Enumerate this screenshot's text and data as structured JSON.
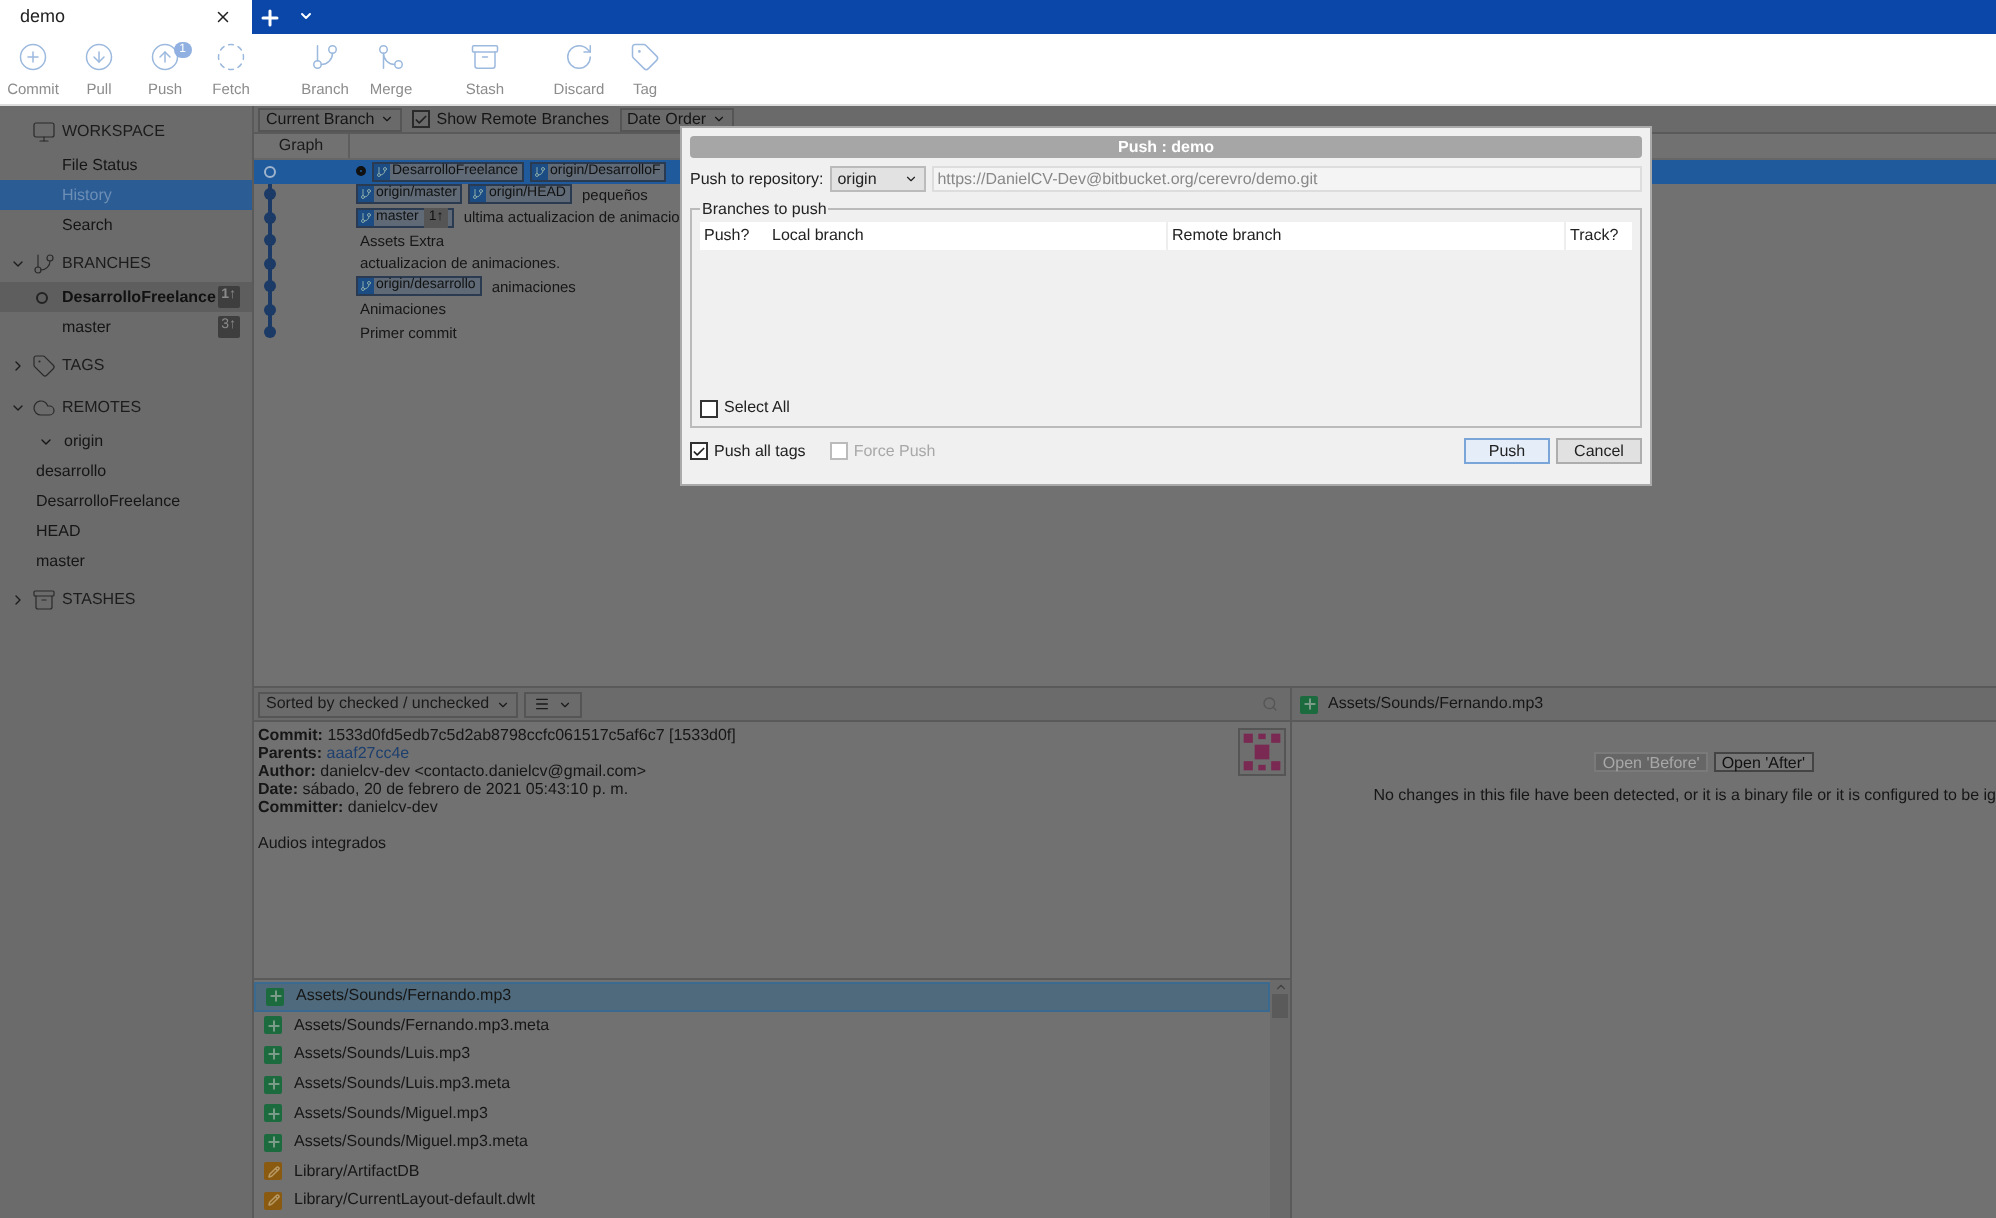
{
  "tabs": [
    {
      "label": "demo",
      "selected": true
    }
  ],
  "toolbar": [
    {
      "kind": "commit",
      "label": "Commit"
    },
    {
      "kind": "pull",
      "label": "Pull"
    },
    {
      "kind": "push",
      "label": "Push",
      "badge": "1"
    },
    {
      "kind": "fetch",
      "label": "Fetch"
    },
    {
      "kind": "branch",
      "label": "Branch"
    },
    {
      "kind": "merge",
      "label": "Merge"
    },
    {
      "kind": "stash",
      "label": "Stash"
    },
    {
      "kind": "discard",
      "label": "Discard"
    },
    {
      "kind": "tag",
      "label": "Tag"
    }
  ],
  "sidebar": [
    {
      "kind": "workspace",
      "label": "WORKSPACE",
      "children": [
        {
          "label": "File Status",
          "selected": false
        },
        {
          "label": "History",
          "selected": true
        },
        {
          "label": "Search",
          "selected": false
        }
      ]
    },
    {
      "kind": "branches",
      "label": "BRANCHES",
      "expanded": true,
      "children": [
        {
          "label": "DesarrolloFreelance",
          "current": true,
          "badge": "1↑"
        },
        {
          "label": "master",
          "current": false,
          "badge": "3↑"
        }
      ]
    },
    {
      "kind": "tags",
      "label": "TAGS",
      "expanded": false
    },
    {
      "kind": "remotes",
      "label": "REMOTES",
      "expanded": true,
      "children": [
        {
          "label": "origin",
          "expanded": true,
          "children": [
            {
              "label": "desarrollo"
            },
            {
              "label": "DesarrolloFreelance"
            },
            {
              "label": "HEAD"
            },
            {
              "label": "master"
            }
          ]
        }
      ]
    },
    {
      "kind": "stashes",
      "label": "STASHES",
      "expanded": false
    }
  ],
  "filter_bar": {
    "branch_filter": "Current Branch",
    "show_remote": {
      "label": "Show Remote Branches",
      "checked": true
    },
    "order": "Date Order"
  },
  "graph": {
    "column": "Graph",
    "rows": [
      {
        "selected": true,
        "head": true,
        "refs": [
          {
            "name": "DesarrolloFreelance"
          },
          {
            "name": "origin/DesarrolloF"
          }
        ]
      },
      {
        "selected": false,
        "head": false,
        "refs": [
          {
            "name": "origin/master"
          },
          {
            "name": "origin/HEAD"
          }
        ],
        "message": "pequeños"
      },
      {
        "selected": false,
        "head": false,
        "refs": [
          {
            "name": "master",
            "badge": "1↑"
          }
        ],
        "message": "ultima actualizacion de animacio"
      },
      {
        "selected": false,
        "head": false,
        "refs": [],
        "message": "Assets Extra"
      },
      {
        "selected": false,
        "head": false,
        "refs": [],
        "message": "actualizacion de animaciones."
      },
      {
        "selected": false,
        "head": false,
        "refs": [
          {
            "name": "origin/desarrollo"
          }
        ],
        "message": "animaciones"
      },
      {
        "selected": false,
        "head": false,
        "refs": [],
        "message": "Animaciones"
      },
      {
        "selected": false,
        "head": false,
        "refs": [],
        "message": "Primer commit"
      }
    ]
  },
  "dialog": {
    "title": "Push : demo",
    "repo_label": "Push to repository:",
    "repo": "origin",
    "url": "https://DanielCV-Dev@bitbucket.org/cerevro/demo.git",
    "group": "Branches to push",
    "columns": [
      "Push?",
      "Local branch",
      "Remote branch",
      "Track?"
    ],
    "select_all": {
      "label": "Select All",
      "checked": false
    },
    "options": [
      {
        "label": "Push all tags",
        "checked": true,
        "disabled": false
      },
      {
        "label": "Force Push",
        "checked": false,
        "disabled": true
      }
    ],
    "buttons": [
      {
        "label": "Push",
        "default": true
      },
      {
        "label": "Cancel",
        "default": false
      }
    ]
  },
  "details": {
    "sort": "Sorted by checked / unchecked",
    "fields": [
      {
        "label": "Commit:",
        "value": "1533d0fd5edb7c5d2ab8798ccfc061517c5af6c7 [1533d0f]",
        "link": false
      },
      {
        "label": "Parents:",
        "value": "aaaf27cc4e",
        "link": true
      },
      {
        "label": "Author:",
        "value": "danielcv-dev <contacto.danielcv@gmail.com>",
        "link": false
      },
      {
        "label": "Date:",
        "value": "sábado, 20 de febrero de 2021 05:43:10 p. m.",
        "link": false
      },
      {
        "label": "Committer:",
        "value": "danielcv-dev",
        "link": false
      }
    ],
    "message": "Audios integrados"
  },
  "files": [
    {
      "kind": "added",
      "path": "Assets/Sounds/Fernando.mp3",
      "selected": true
    },
    {
      "kind": "added",
      "path": "Assets/Sounds/Fernando.mp3.meta",
      "selected": false
    },
    {
      "kind": "added",
      "path": "Assets/Sounds/Luis.mp3",
      "selected": false
    },
    {
      "kind": "added",
      "path": "Assets/Sounds/Luis.mp3.meta",
      "selected": false
    },
    {
      "kind": "added",
      "path": "Assets/Sounds/Miguel.mp3",
      "selected": false
    },
    {
      "kind": "added",
      "path": "Assets/Sounds/Miguel.mp3.meta",
      "selected": false
    },
    {
      "kind": "modified",
      "path": "Library/ArtifactDB",
      "selected": false
    },
    {
      "kind": "modified",
      "path": "Library/CurrentLayout-default.dwlt",
      "selected": false
    }
  ],
  "diff": {
    "file": {
      "kind": "added",
      "path": "Assets/Sounds/Fernando.mp3"
    },
    "buttons": [
      {
        "label": "Open 'Before'",
        "disabled": true
      },
      {
        "label": "Open 'After'",
        "disabled": false
      }
    ],
    "message": "No changes in this file have been detected, or it is a binary file or it is configured to be ig"
  }
}
